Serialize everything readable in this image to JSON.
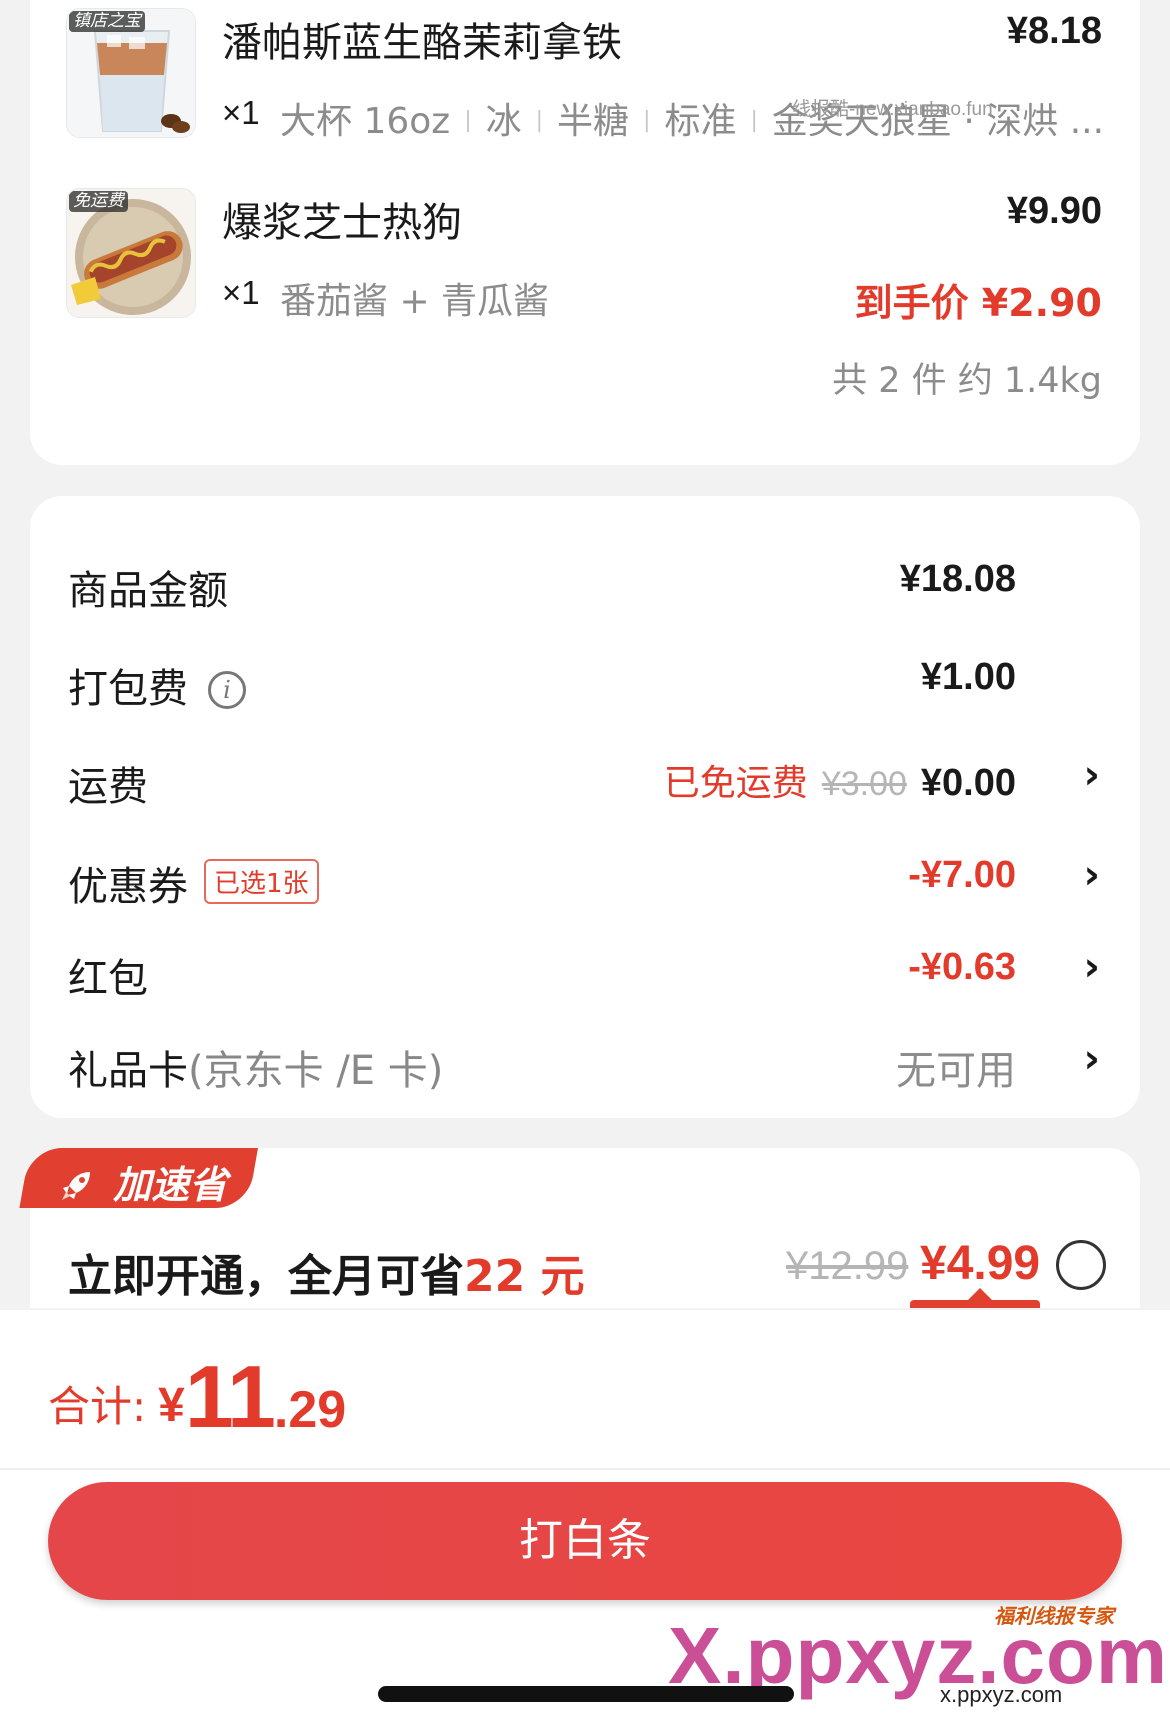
{
  "products": [
    {
      "thumb_tag": "镇店之宝",
      "name": "潘帕斯蓝生酪茉莉拿铁",
      "price": "¥8.18",
      "qty": "×1",
      "specs": [
        "大杯 16oz",
        "冰",
        "半糖",
        "标准",
        "金奖天狼星 · 深烘 ..."
      ]
    },
    {
      "thumb_tag": "免运费",
      "name": "爆浆芝士热狗",
      "price": "¥9.90",
      "qty": "×1",
      "spec_text": "番茄酱 + 青瓜酱",
      "deal_price": "到手价 ¥2.90"
    }
  ],
  "summary_count": "共 2 件 约 1.4kg",
  "watermark_small": "线报酷-new.xianbao.fun",
  "fees": {
    "goods_label": "商品金额",
    "goods_value": "¥18.08",
    "packing_label": "打包费",
    "packing_info_icon": "i",
    "packing_value": "¥1.00",
    "shipping_label": "运费",
    "shipping_free": "已免运费",
    "shipping_original": "¥3.00",
    "shipping_value": "¥0.00",
    "coupon_label": "优惠券",
    "coupon_badge": "已选1张",
    "coupon_value": "-¥7.00",
    "redpacket_label": "红包",
    "redpacket_value": "-¥0.63",
    "giftcard_label": "礼品卡",
    "giftcard_sub": "(京东卡 /E 卡)",
    "giftcard_value": "无可用",
    "chevron": "›"
  },
  "member": {
    "tag": "加速省",
    "text_prefix": "立即开通，全月可省",
    "text_amount": "22 元",
    "old_price": "¥12.99",
    "new_price": "¥4.99"
  },
  "bottom": {
    "total_label": "合计:",
    "total_currency": "¥",
    "total_int": "11",
    "total_dec": ".29",
    "pay_label": "打白条"
  },
  "watermark": {
    "brand": "福利线报专家",
    "logo": "X.ppxyz.com",
    "url": "x.ppxyz.com"
  },
  "colors": {
    "accent_red": "#e33b2b",
    "button_red": "#e4464a",
    "muted_gray": "#8c8c8c"
  }
}
